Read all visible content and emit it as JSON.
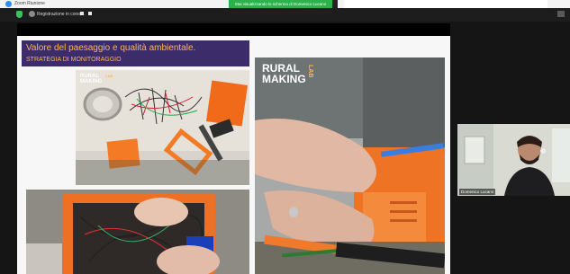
{
  "app": {
    "title": "Zoom Riunione",
    "share_banner": "Stai visualizzando lo schermo di Domenico Lucano",
    "recording_label": "Registrazione in corso..."
  },
  "slide": {
    "title": "Valore del paesaggio e qualità ambientale.",
    "subtitle": "STRATEGIA DI MONITORAGGIO",
    "logo_large": {
      "line1": "RURAL",
      "line2": "MAKING",
      "tag": "LAB"
    },
    "logo_small": {
      "line1": "RURAL",
      "line2": "MAKING",
      "tag": "LAB"
    }
  },
  "participant": {
    "name": "Domenico Lucano"
  },
  "colors": {
    "accent_orange": "#ffb54a",
    "title_box": "#3d2c6a",
    "share_green": "#2bb24a",
    "zoom_blue": "#2d8cff"
  }
}
